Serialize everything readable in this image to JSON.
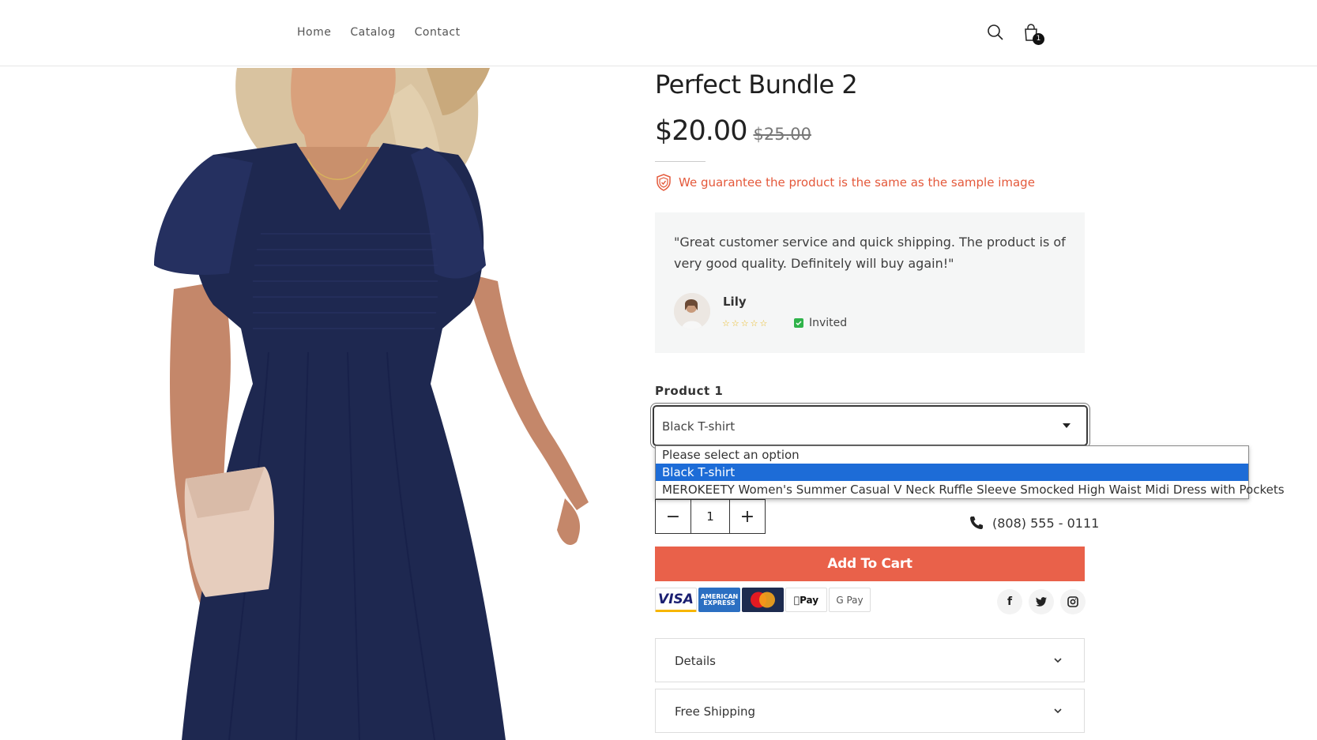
{
  "nav": {
    "home": "Home",
    "catalog": "Catalog",
    "contact": "Contact"
  },
  "cart": {
    "count": "1"
  },
  "product": {
    "title": "Perfect Bundle 2",
    "price": "$20.00",
    "old_price": "$25.00",
    "guarantee": "We guarantee the product is the same as the sample image"
  },
  "review": {
    "text": "\"Great customer service and quick shipping. The product is of very good quality. Definitely will buy again!\"",
    "name": "Lily",
    "rating": 5,
    "invited": "Invited"
  },
  "variant": {
    "label": "Product 1",
    "selected": "Black T-shirt",
    "options": [
      "Please select an option",
      "Black T-shirt",
      "MEROKEETY Women's Summer Casual V Neck Ruffle Sleeve Smocked High Waist Midi Dress with Pockets"
    ],
    "selected_index": 1
  },
  "quantity": {
    "value": "1",
    "minus": "−",
    "plus": "+"
  },
  "phone": "(808) 555 - 0111",
  "add_to_cart": "Add To Cart",
  "payments": {
    "visa": "VISA",
    "amex": "AMERICAN EXPRESS",
    "applepay": "Pay",
    "gpay": "G Pay"
  },
  "socials": {
    "facebook": "f",
    "twitter": "twitter",
    "instagram": "instagram"
  },
  "accordions": [
    "Details",
    "Free Shipping"
  ],
  "colors": {
    "accent": "#e9614a",
    "guarantee": "#e4593b",
    "selected_option": "#1d6cd7",
    "dress": "#1e2850"
  }
}
